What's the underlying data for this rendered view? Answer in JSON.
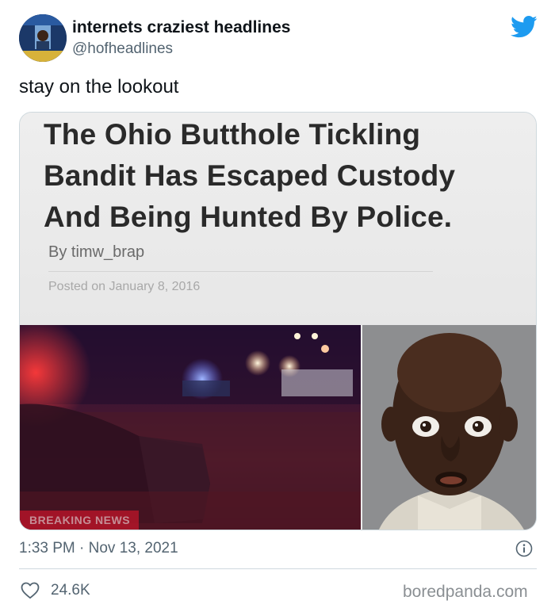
{
  "author": {
    "display_name": "internets craziest headlines",
    "handle": "@hofheadlines"
  },
  "tweet": {
    "text": "stay on the lookout"
  },
  "media": {
    "headline_lines": [
      "The Ohio  Butthole Tickling",
      "Bandit Has Escaped Custody",
      "And Being Hunted By Police."
    ],
    "byline": "By timw_brap",
    "posted": "Posted on January 8, 2016",
    "banner": "BREAKING NEWS"
  },
  "meta": {
    "timestamp": "1:33 PM · Nov 13, 2021",
    "likes": "24.6K",
    "watermark": "boredpanda.com"
  },
  "icons": {
    "brand": "twitter-bird-icon",
    "info": "info-icon",
    "like": "heart-icon"
  },
  "colors": {
    "twitter_blue": "#1d9bf0",
    "secondary_text": "#536471",
    "border": "#cfd9de"
  }
}
